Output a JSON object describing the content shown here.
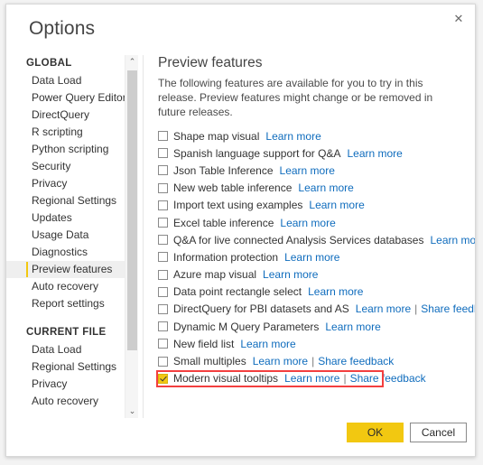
{
  "window": {
    "title": "Options",
    "close_label": "✕"
  },
  "sidebar": {
    "groups": [
      {
        "header": "GLOBAL",
        "items": [
          {
            "label": "Data Load",
            "selected": false
          },
          {
            "label": "Power Query Editor",
            "selected": false
          },
          {
            "label": "DirectQuery",
            "selected": false
          },
          {
            "label": "R scripting",
            "selected": false
          },
          {
            "label": "Python scripting",
            "selected": false
          },
          {
            "label": "Security",
            "selected": false
          },
          {
            "label": "Privacy",
            "selected": false
          },
          {
            "label": "Regional Settings",
            "selected": false
          },
          {
            "label": "Updates",
            "selected": false
          },
          {
            "label": "Usage Data",
            "selected": false
          },
          {
            "label": "Diagnostics",
            "selected": false
          },
          {
            "label": "Preview features",
            "selected": true
          },
          {
            "label": "Auto recovery",
            "selected": false
          },
          {
            "label": "Report settings",
            "selected": false
          }
        ]
      },
      {
        "header": "CURRENT FILE",
        "items": [
          {
            "label": "Data Load",
            "selected": false
          },
          {
            "label": "Regional Settings",
            "selected": false
          },
          {
            "label": "Privacy",
            "selected": false
          },
          {
            "label": "Auto recovery",
            "selected": false
          }
        ]
      }
    ],
    "scrollbar": {
      "up_arrow": "⌃",
      "down_arrow": "⌄"
    }
  },
  "content": {
    "section_title": "Preview features",
    "description": "The following features are available for you to try in this release. Preview features might change or be removed in future releases.",
    "link_learn_more": "Learn more",
    "link_share_feedback": "Share feedback",
    "link_separator": "|",
    "features": [
      {
        "label": "Shape map visual",
        "checked": false,
        "learn_more": true,
        "share_feedback": false
      },
      {
        "label": "Spanish language support for Q&A",
        "checked": false,
        "learn_more": true,
        "share_feedback": false
      },
      {
        "label": "Json Table Inference",
        "checked": false,
        "learn_more": true,
        "share_feedback": false
      },
      {
        "label": "New web table inference",
        "checked": false,
        "learn_more": true,
        "share_feedback": false
      },
      {
        "label": "Import text using examples",
        "checked": false,
        "learn_more": true,
        "share_feedback": false
      },
      {
        "label": "Excel table inference",
        "checked": false,
        "learn_more": true,
        "share_feedback": false
      },
      {
        "label": "Q&A for live connected Analysis Services databases",
        "checked": false,
        "learn_more": true,
        "share_feedback": false
      },
      {
        "label": "Information protection",
        "checked": false,
        "learn_more": true,
        "share_feedback": false
      },
      {
        "label": "Azure map visual",
        "checked": false,
        "learn_more": true,
        "share_feedback": false
      },
      {
        "label": "Data point rectangle select",
        "checked": false,
        "learn_more": true,
        "share_feedback": false
      },
      {
        "label": "DirectQuery for PBI datasets and AS",
        "checked": false,
        "learn_more": true,
        "share_feedback": true
      },
      {
        "label": "Dynamic M Query Parameters",
        "checked": false,
        "learn_more": true,
        "share_feedback": false
      },
      {
        "label": "New field list",
        "checked": false,
        "learn_more": true,
        "share_feedback": false
      },
      {
        "label": "Small multiples",
        "checked": false,
        "learn_more": true,
        "share_feedback": true
      },
      {
        "label": "Modern visual tooltips",
        "checked": true,
        "learn_more": true,
        "share_feedback": true
      }
    ],
    "highlighted_feature_index": 14
  },
  "footer": {
    "ok_label": "OK",
    "cancel_label": "Cancel"
  },
  "colors": {
    "accent": "#f2c811",
    "link": "#0f6cbd",
    "highlight_border": "#f33f3f"
  }
}
